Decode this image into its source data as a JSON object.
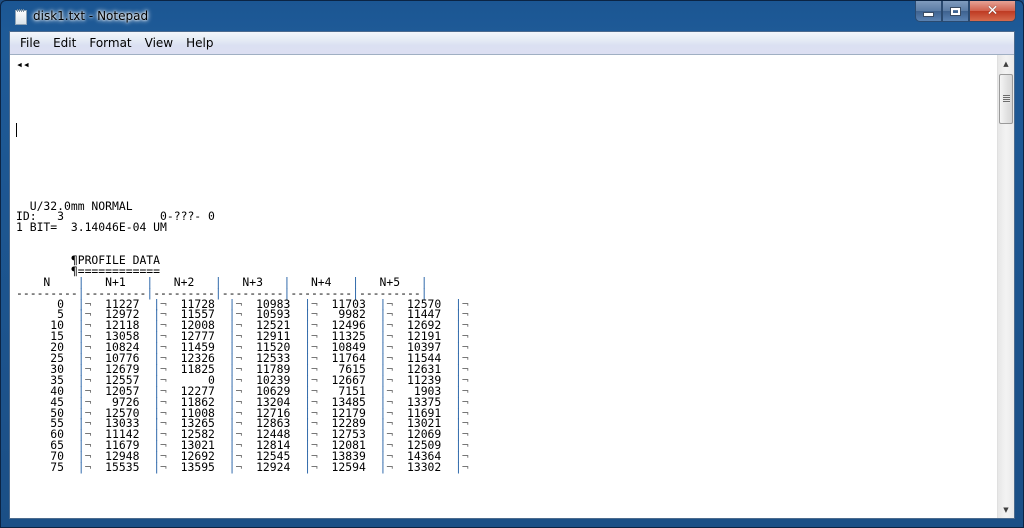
{
  "window": {
    "title": "disk1.txt - Notepad",
    "close_glyph": "✕"
  },
  "menu": {
    "items": [
      "File",
      "Edit",
      "Format",
      "View",
      "Help"
    ]
  },
  "document": {
    "first_line": "◂◂",
    "header": {
      "line1": "  U/32.0mm NORMAL",
      "line2": "ID:   3              0-???- 0",
      "line3": "1 BIT=  3.14046E-04 UM"
    },
    "section_title": "        ¶PROFILE DATA",
    "section_underline": "        ¶============",
    "table": {
      "columns": [
        "N",
        "N+1",
        "N+2",
        "N+3",
        "N+4",
        "N+5"
      ],
      "rows": [
        {
          "n": "0",
          "values": [
            "11227",
            "11728",
            "10983",
            "11703",
            "12570"
          ]
        },
        {
          "n": "5",
          "values": [
            "12972",
            "11557",
            "10593",
            "9982",
            "11447"
          ]
        },
        {
          "n": "10",
          "values": [
            "12118",
            "12008",
            "12521",
            "12496",
            "12692"
          ]
        },
        {
          "n": "15",
          "values": [
            "13058",
            "12777",
            "12911",
            "11325",
            "12191"
          ]
        },
        {
          "n": "20",
          "values": [
            "10824",
            "11459",
            "11520",
            "10849",
            "10397"
          ]
        },
        {
          "n": "25",
          "values": [
            "10776",
            "12326",
            "12533",
            "11764",
            "11544"
          ]
        },
        {
          "n": "30",
          "values": [
            "12679",
            "11825",
            "11789",
            "7615",
            "12631"
          ]
        },
        {
          "n": "35",
          "values": [
            "12557",
            "0",
            "10239",
            "12667",
            "11239"
          ]
        },
        {
          "n": "40",
          "values": [
            "12057",
            "12277",
            "10629",
            "7151",
            "1903"
          ]
        },
        {
          "n": "45",
          "values": [
            "9726",
            "11862",
            "13204",
            "13485",
            "13375"
          ]
        },
        {
          "n": "50",
          "values": [
            "12570",
            "11008",
            "12716",
            "12179",
            "11691"
          ]
        },
        {
          "n": "55",
          "values": [
            "13033",
            "13265",
            "12863",
            "12289",
            "13021"
          ]
        },
        {
          "n": "60",
          "values": [
            "11142",
            "12582",
            "12448",
            "12753",
            "12069"
          ]
        },
        {
          "n": "65",
          "values": [
            "11679",
            "13021",
            "12814",
            "12081",
            "12509"
          ]
        },
        {
          "n": "70",
          "values": [
            "12948",
            "12692",
            "12545",
            "13839",
            "14364"
          ]
        },
        {
          "n": "75",
          "values": [
            "15535",
            "13595",
            "12924",
            "12594",
            "13302"
          ]
        }
      ]
    }
  },
  "scrollbar": {
    "up_glyph": "▲",
    "down_glyph": "▼"
  }
}
